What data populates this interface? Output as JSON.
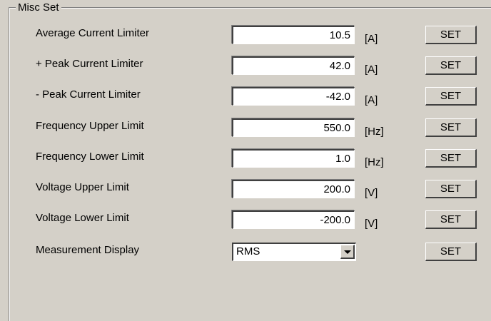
{
  "group": {
    "title": "Misc Set"
  },
  "rows": [
    {
      "label": "Average Current Limiter",
      "value": "10.5",
      "unit": "[A]",
      "button": "SET"
    },
    {
      "label": "+ Peak Current Limiter",
      "value": "42.0",
      "unit": "[A]",
      "button": "SET"
    },
    {
      "label": "- Peak Current Limiter",
      "value": "-42.0",
      "unit": "[A]",
      "button": "SET"
    },
    {
      "label": "Frequency Upper Limit",
      "value": "550.0",
      "unit": "[Hz]",
      "button": "SET"
    },
    {
      "label": "Frequency Lower Limit",
      "value": "1.0",
      "unit": "[Hz]",
      "button": "SET"
    },
    {
      "label": "Voltage Upper Limit",
      "value": "200.0",
      "unit": "[V]",
      "button": "SET"
    },
    {
      "label": "Voltage Lower Limit",
      "value": "-200.0",
      "unit": "[V]",
      "button": "SET"
    }
  ],
  "measurement": {
    "label": "Measurement Display",
    "selected": "RMS",
    "button": "SET"
  },
  "icons": {
    "dropdown": "chevron-down-icon"
  }
}
